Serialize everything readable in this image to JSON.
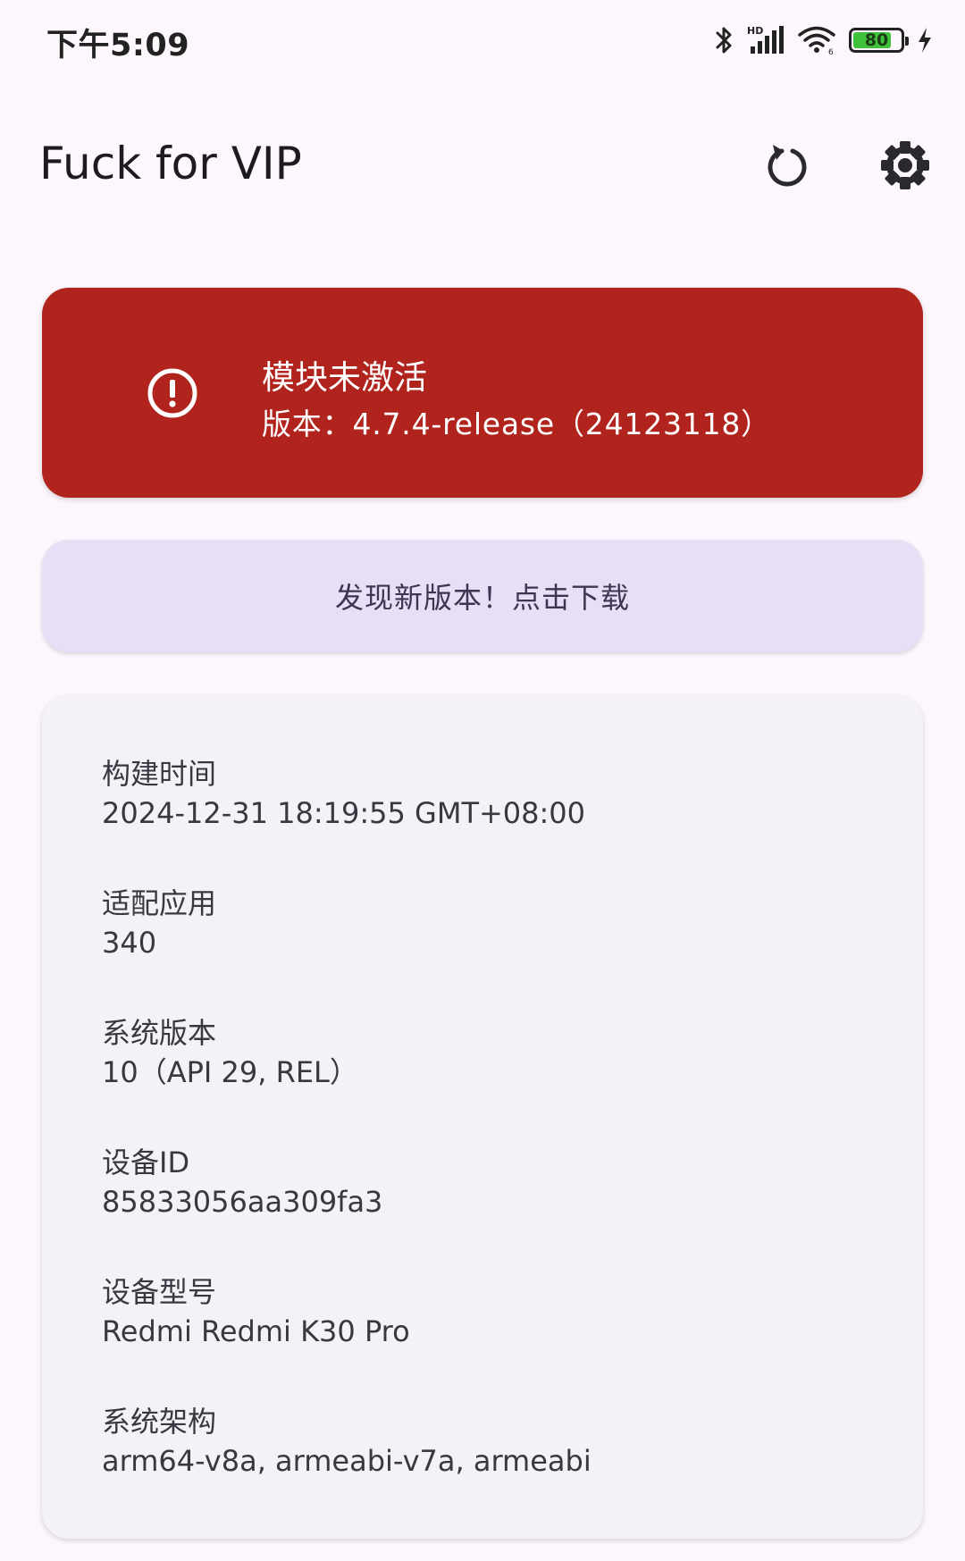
{
  "status_bar": {
    "time": "下午5:09",
    "battery_level": 80,
    "battery_text": "80",
    "icons": [
      "bluetooth-icon",
      "hd-signal-icon",
      "wifi-icon",
      "battery-icon",
      "charging-icon"
    ]
  },
  "app_bar": {
    "title": "Fuck for VIP",
    "actions": [
      "refresh-icon",
      "settings-icon"
    ]
  },
  "status_card": {
    "title": "模块未激活",
    "version": "版本：4.7.4-release（24123118）",
    "icon": "error-circle-icon",
    "color": "#b1241d"
  },
  "update_banner": {
    "text": "发现新版本！点击下载"
  },
  "info": {
    "items": [
      {
        "label": "构建时间",
        "value": "2024-12-31 18:19:55 GMT+08:00"
      },
      {
        "label": "适配应用",
        "value": "340"
      },
      {
        "label": "系统版本",
        "value": "10（API 29, REL）"
      },
      {
        "label": "设备ID",
        "value": "85833056aa309fa3"
      },
      {
        "label": "设备型号",
        "value": "Redmi Redmi K30 Pro"
      },
      {
        "label": "系统架构",
        "value": "arm64-v8a, armeabi-v7a, armeabi"
      }
    ]
  }
}
